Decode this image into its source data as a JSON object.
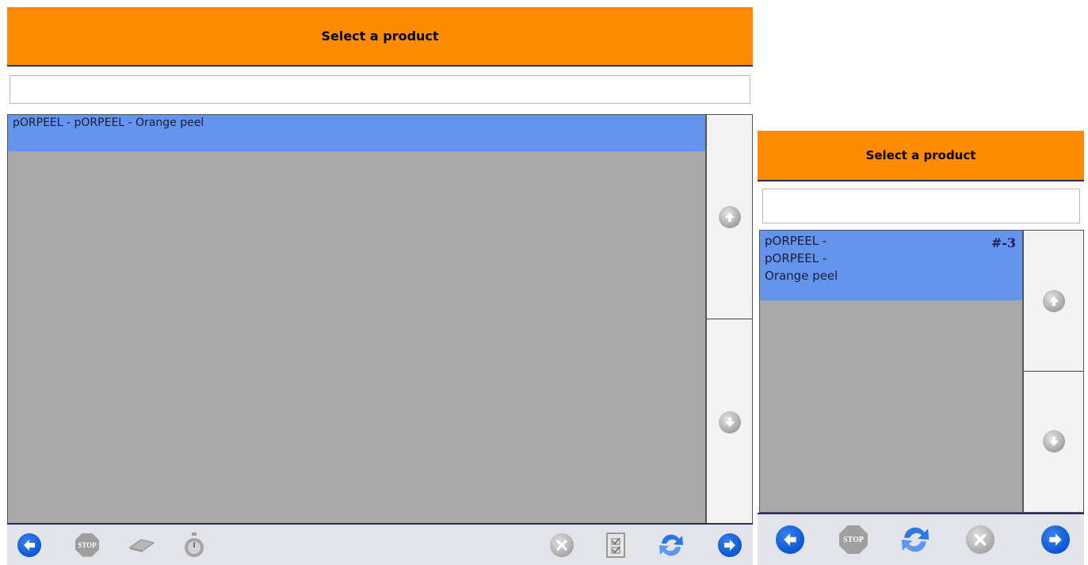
{
  "left": {
    "header_title": "Select a product",
    "search": {
      "value": "",
      "placeholder": ""
    },
    "items": [
      {
        "label": "pORPEEL - pORPEEL - Orange peel"
      }
    ],
    "toolbar": [
      "back-arrow-icon",
      "stop-icon",
      "eraser-icon",
      "stopwatch-icon",
      "cancel-icon",
      "checklist-icon",
      "refresh-icon",
      "forward-arrow-icon"
    ]
  },
  "right": {
    "header_title": "Select a product",
    "search": {
      "value": "",
      "placeholder": ""
    },
    "items": [
      {
        "line1": "pORPEEL -",
        "line2": "pORPEEL -",
        "line3": "Orange peel",
        "badge": "#-3"
      }
    ],
    "toolbar": [
      "back-arrow-icon",
      "stop-icon",
      "refresh-icon",
      "cancel-icon",
      "forward-arrow-icon"
    ]
  },
  "icon_labels": {
    "stop": "STOP"
  },
  "colors": {
    "header": "#ff8c00",
    "selected_row": "#6495ed",
    "list_bg": "#a9a9a9",
    "accent_blue": "#0b57d0"
  }
}
